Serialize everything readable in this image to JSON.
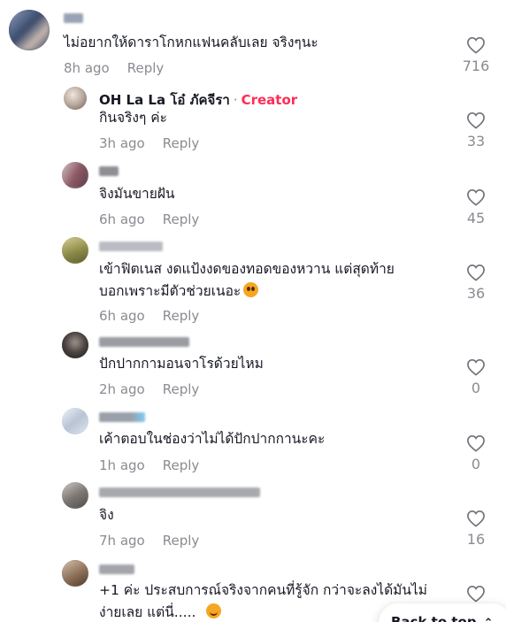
{
  "comments": [
    {
      "text": "ไม่อยากให้ดาราโกหกแฟนคลับเลย จริงๆนะ",
      "time": "8h ago",
      "reply_label": "Reply",
      "likes": "716",
      "colors": {
        "avatar": [
          "#6a7fa0",
          "#3a4a6a",
          "#c8b8b0"
        ],
        "name": "#9aa3b5"
      }
    },
    {
      "author": "OH La La โอ๋ ภัคจีรา",
      "author_tag": "Creator",
      "text": "กินจริงๆ ค่ะ",
      "time": "3h ago",
      "reply_label": "Reply",
      "likes": "33"
    },
    {
      "text": "จิงมันขายฝัน",
      "time": "6h ago",
      "reply_label": "Reply",
      "likes": "45"
    },
    {
      "text_line1": "เข้าฟิตเนส งดแป้งงดของทอดของหวาน แต่สุดท้าย",
      "text_line2": "บอกเพราะมีตัวช่วยเนอะ",
      "emoji": "pleading-face",
      "time": "6h ago",
      "reply_label": "Reply",
      "likes": "36"
    },
    {
      "text": "ปักปากกามอนจาโรด้วยไหม",
      "time": "2h ago",
      "reply_label": "Reply",
      "likes": "0"
    },
    {
      "text": "เค้าตอบในช่องว่าไม่ได้ปักปากกานะคะ",
      "time": "1h ago",
      "reply_label": "Reply",
      "likes": "0"
    },
    {
      "text": "จิง",
      "time": "7h ago",
      "reply_label": "Reply",
      "likes": "16"
    },
    {
      "text_line1": "+1 ค่ะ ประสบการณ์จริงจากคนที่รู้จัก กว่าจะลงได้มันไม่",
      "text_line2": "ง่ายเลย แต่นี่.....",
      "emoji": "smiling-face-with-sweat"
    }
  ],
  "back_to_top": "Back to top"
}
